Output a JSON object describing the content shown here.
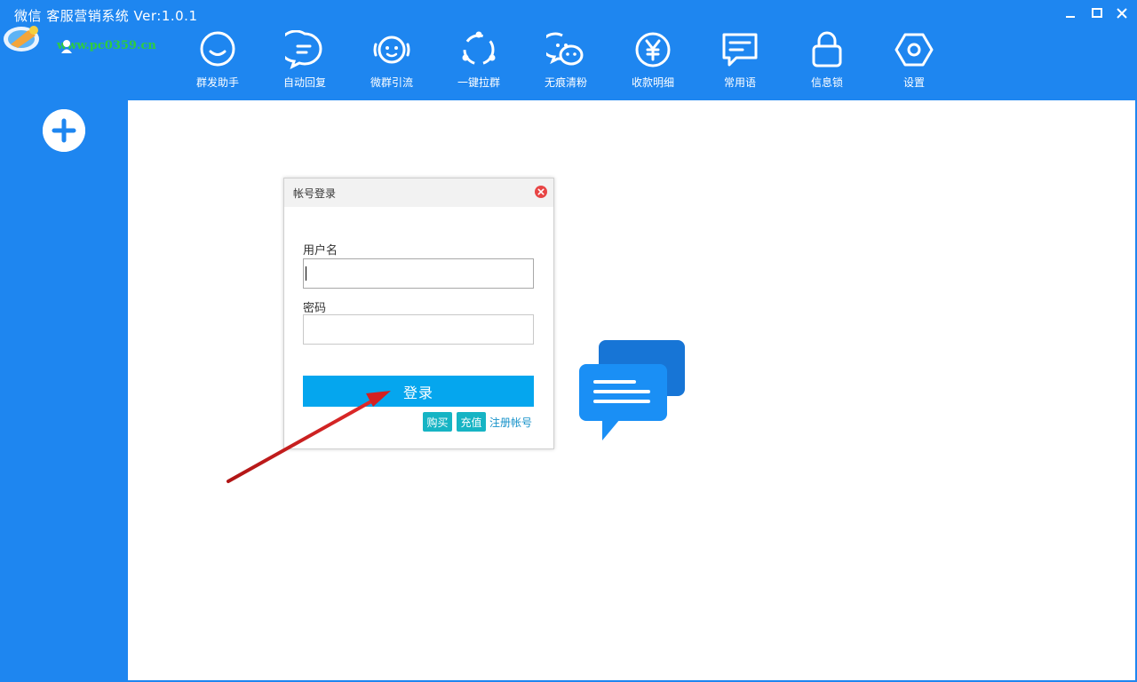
{
  "window": {
    "title": "微信 客服营销系统 Ver:1.0.1",
    "watermark": "www.pc0359.cn",
    "controls": [
      "minimize-icon",
      "maximize-icon",
      "close-icon"
    ]
  },
  "toolbar": {
    "items": [
      {
        "label": "群发助手",
        "icon": "smile-chat-icon"
      },
      {
        "label": "自动回复",
        "icon": "message-lines-icon"
      },
      {
        "label": "微群引流",
        "icon": "broadcast-face-icon"
      },
      {
        "label": "一键拉群",
        "icon": "group-circle-icon"
      },
      {
        "label": "无痕清粉",
        "icon": "wechat-icon"
      },
      {
        "label": "收款明细",
        "icon": "yen-icon"
      },
      {
        "label": "常用语",
        "icon": "speech-lines-icon"
      },
      {
        "label": "信息锁",
        "icon": "lock-icon"
      },
      {
        "label": "设置",
        "icon": "hexagon-gear-icon"
      }
    ]
  },
  "sidebar": {
    "add_icon": "plus-circle-icon"
  },
  "login_dialog": {
    "title": "帐号登录",
    "username_label": "用户名",
    "username_value": "",
    "password_label": "密码",
    "password_value": "",
    "login_button": "登录",
    "buy_button": "购买",
    "recharge_button": "充值",
    "register_link": "注册帐号"
  },
  "colors": {
    "brand_blue": "#1e86f0",
    "login_button": "#05a6ee",
    "small_buttons": "#16b4c4",
    "annotation_arrow": "#d42020"
  }
}
